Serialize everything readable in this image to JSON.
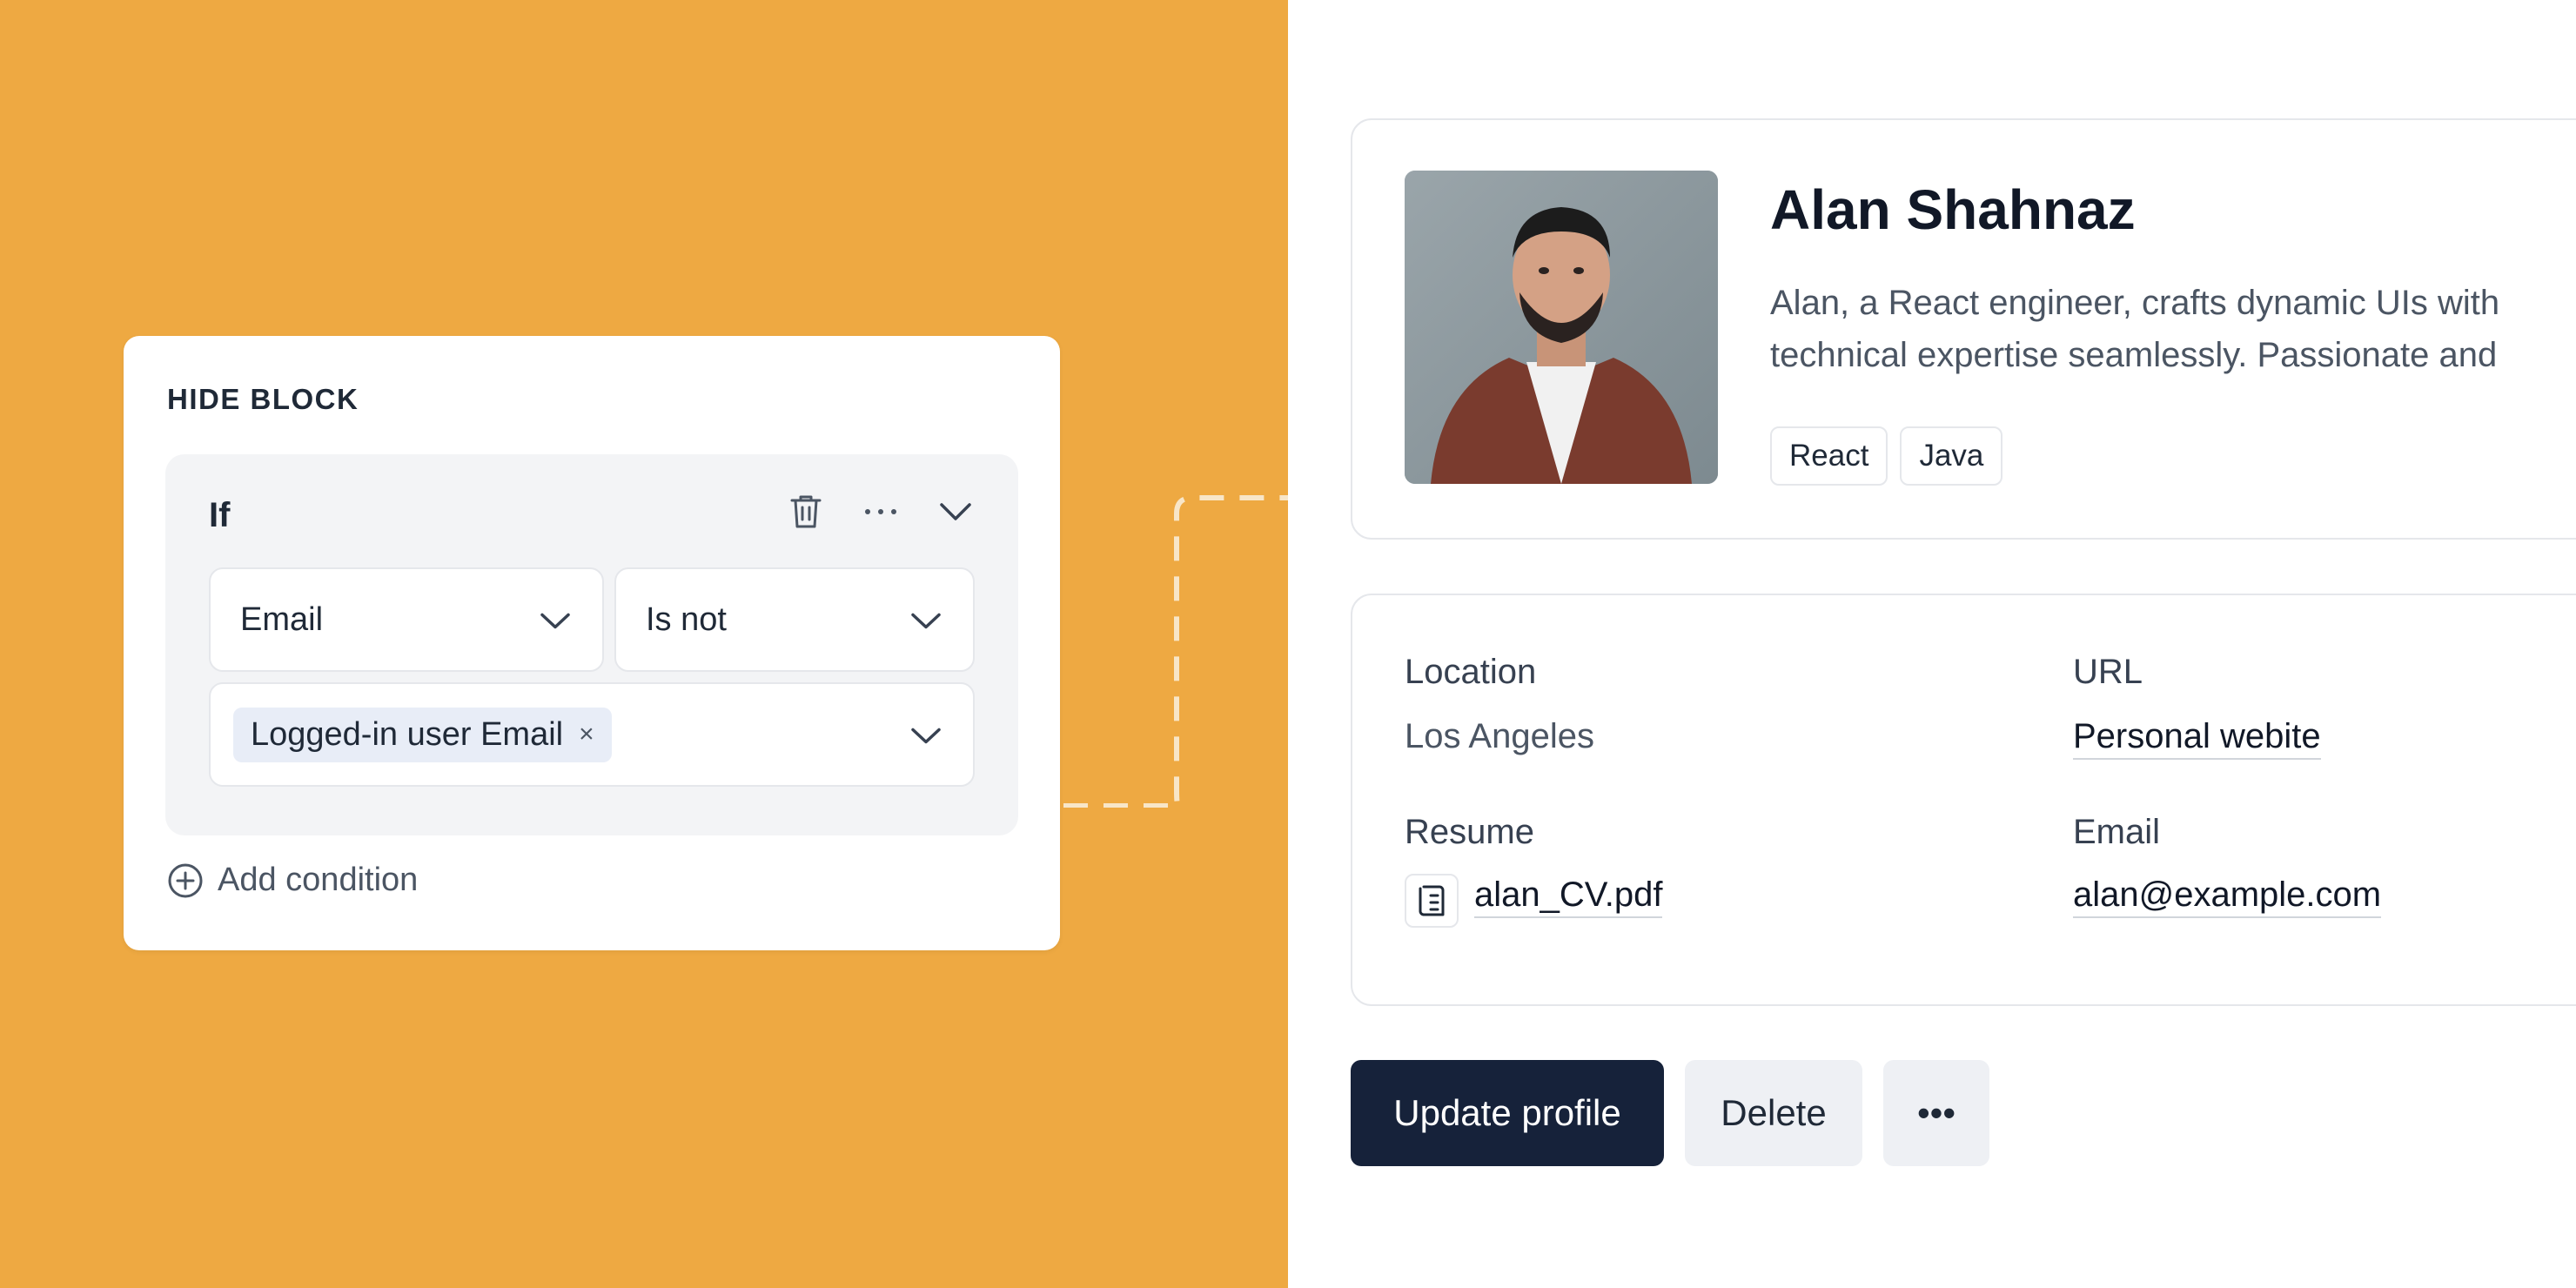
{
  "colors": {
    "left_background": "#eea942",
    "primary_button": "#16223a",
    "secondary_button": "#eef0f4"
  },
  "hide_block": {
    "title": "HIDE BLOCK",
    "if_label": "If",
    "actions": [
      {
        "icon": "trash-icon"
      },
      {
        "icon": "more-horizontal-icon"
      },
      {
        "icon": "chevron-down-icon"
      }
    ],
    "field_select": {
      "value": "Email"
    },
    "operator_select": {
      "value": "Is not"
    },
    "value_select": {
      "chip": "Logged-in user Email",
      "chip_remove": "×"
    },
    "add_condition_label": "Add condition"
  },
  "profile": {
    "name": "Alan Shahnaz",
    "bio_line1": "Alan, a React engineer, crafts dynamic UIs with",
    "bio_line2": "technical expertise seamlessly. Passionate and",
    "tags": [
      "React",
      "Java"
    ]
  },
  "details": {
    "location_label": "Location",
    "location_value": "Los Angeles",
    "url_label": "URL",
    "url_value": "Personal webite",
    "resume_label": "Resume",
    "resume_file": "alan_CV.pdf",
    "email_label": "Email",
    "email_value": "alan@example.com"
  },
  "actions": {
    "update_label": "Update profile",
    "delete_label": "Delete",
    "more_label": "•••"
  }
}
